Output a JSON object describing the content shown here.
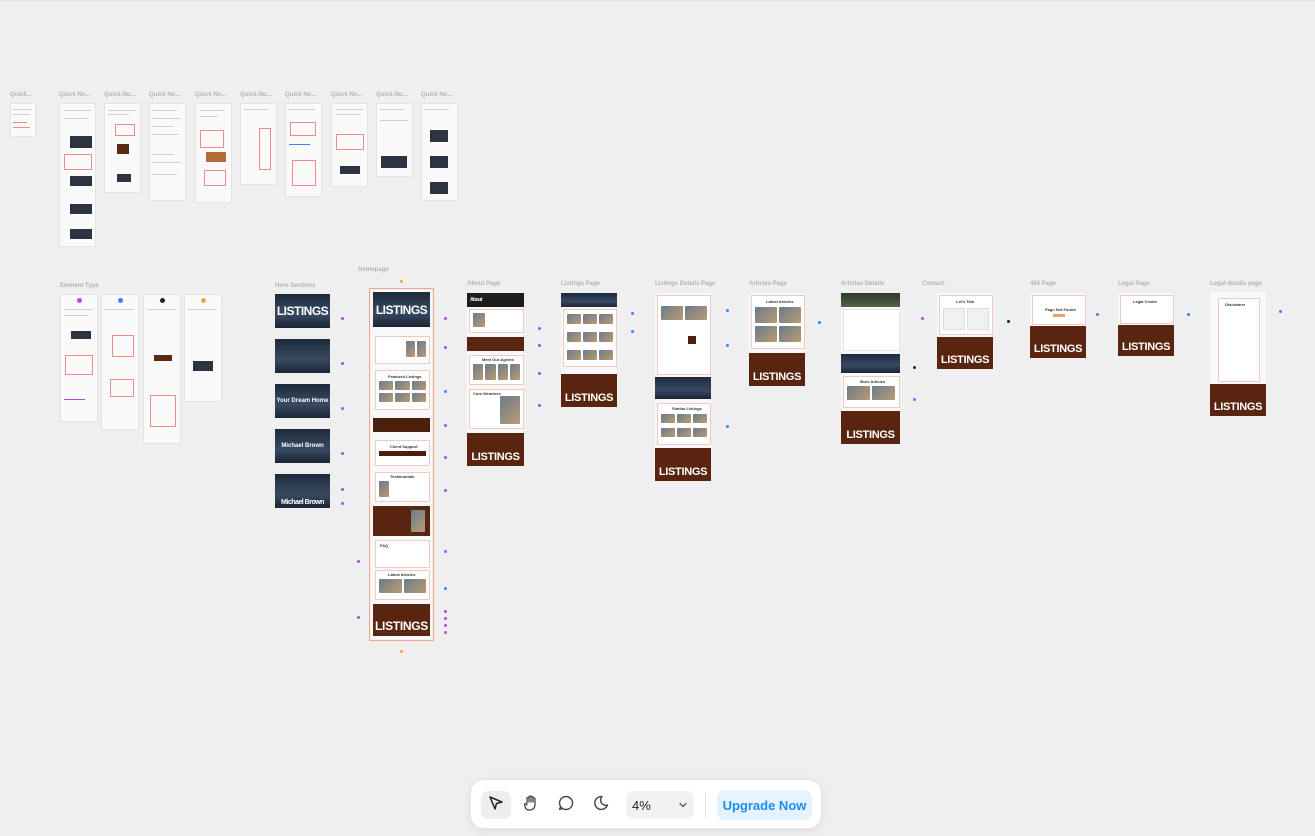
{
  "canvas": {
    "quick_note_labels": [
      "Quick...",
      "Quick No...",
      "Quick No...",
      "Quick No...",
      "Quick No...",
      "Quick No...",
      "Quick No...",
      "Quick No...",
      "Quick No...",
      "Quick No..."
    ],
    "section_labels": {
      "element_type": "Element Type",
      "hero_sections": "Hero Sections",
      "homepage": "Homepage",
      "about_page": "About Page",
      "listings_page": "Listings Page",
      "listings_details_page": "Listings Details Page",
      "articles_page": "Articles Page",
      "articles_details": "Articles Details",
      "contact": "Contact",
      "page_404": "404 Page",
      "legal_page": "Legal Page",
      "legal_details_page": "Legal details page"
    },
    "footer_word": "LISTINGS",
    "hero_texts": {
      "listings": "LISTINGS",
      "dream_home": "Your Dream Home",
      "agent_name": "Michael Brown",
      "about": "About"
    },
    "section_titles": {
      "featured_listings": "Featured Listings",
      "client_support": "Client Support",
      "testimonials": "Testimonials",
      "faq": "FAQ",
      "latest_articles": "Latest Articles",
      "meet_agents": "Meet Our Agents",
      "core_members": "Core Members",
      "similar_listings": "Similar Listings",
      "more_articles": "More Articles",
      "lets_talk": "Let's Talk",
      "page_not_found": "Page Not Found",
      "legal_center": "Legal Center",
      "disclaimer": "Disclaimer"
    }
  },
  "toolbar": {
    "tools": [
      "pointer-tool",
      "hand-tool",
      "comment-tool",
      "dark-mode-toggle"
    ],
    "zoom_value": "4%",
    "upgrade_label": "Upgrade Now"
  }
}
